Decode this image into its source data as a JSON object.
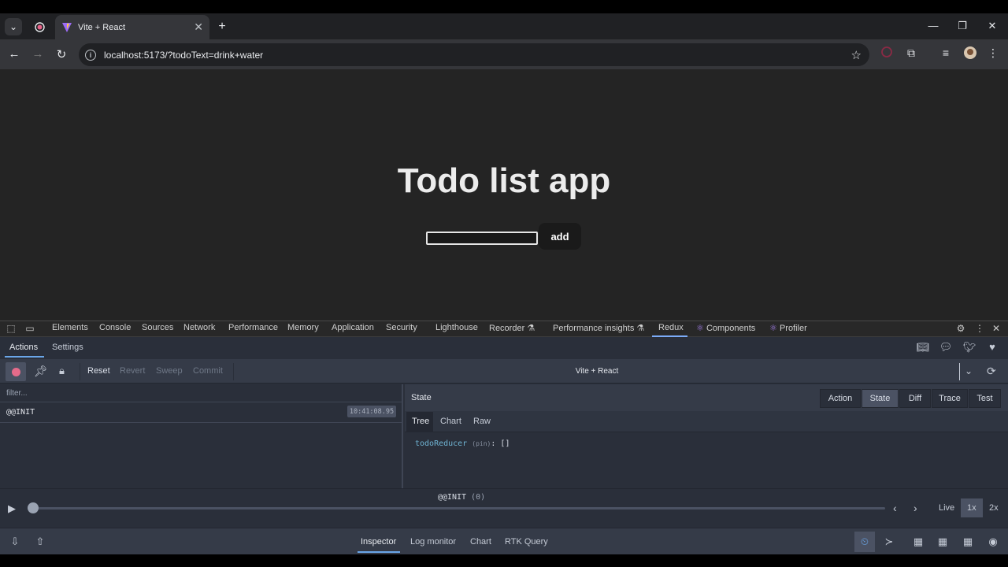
{
  "browser": {
    "tab_title": "Vite + React",
    "url": "localhost:5173/?todoText=drink+water"
  },
  "page": {
    "title": "Todo list app",
    "input_value": "",
    "add_label": "add"
  },
  "devtools": {
    "tabs": [
      "Elements",
      "Console",
      "Sources",
      "Network",
      "Performance",
      "Memory",
      "Application",
      "Security",
      "Lighthouse",
      "Recorder",
      "Performance insights",
      "Redux",
      "Components",
      "Profiler"
    ],
    "flask_glyph": "⚗",
    "react_glyph": "⚛"
  },
  "redux": {
    "subtabs": {
      "actions": "Actions",
      "settings": "Settings"
    },
    "toolbar": {
      "reset": "Reset",
      "revert": "Revert",
      "sweep": "Sweep",
      "commit": "Commit"
    },
    "instance": "Vite + React",
    "filter_placeholder": "filter...",
    "actions": [
      {
        "name": "@@INIT",
        "time": "10:41:08.95"
      }
    ],
    "right_title": "State",
    "monitor_tabs": {
      "action": "Action",
      "state": "State",
      "diff": "Diff",
      "trace": "Trace",
      "test": "Test"
    },
    "view_tabs": {
      "tree": "Tree",
      "chart": "Chart",
      "raw": "Raw"
    },
    "state_tree": {
      "key": "todoReducer",
      "pin": "(pin)",
      "value": "[]"
    },
    "slider": {
      "label": "@@INIT",
      "count": "(0)"
    },
    "speed": {
      "live": "Live",
      "x1": "1x",
      "x2": "2x"
    },
    "bottom_tabs": {
      "inspector": "Inspector",
      "log_monitor": "Log monitor",
      "chart": "Chart",
      "rtk": "RTK Query"
    }
  }
}
